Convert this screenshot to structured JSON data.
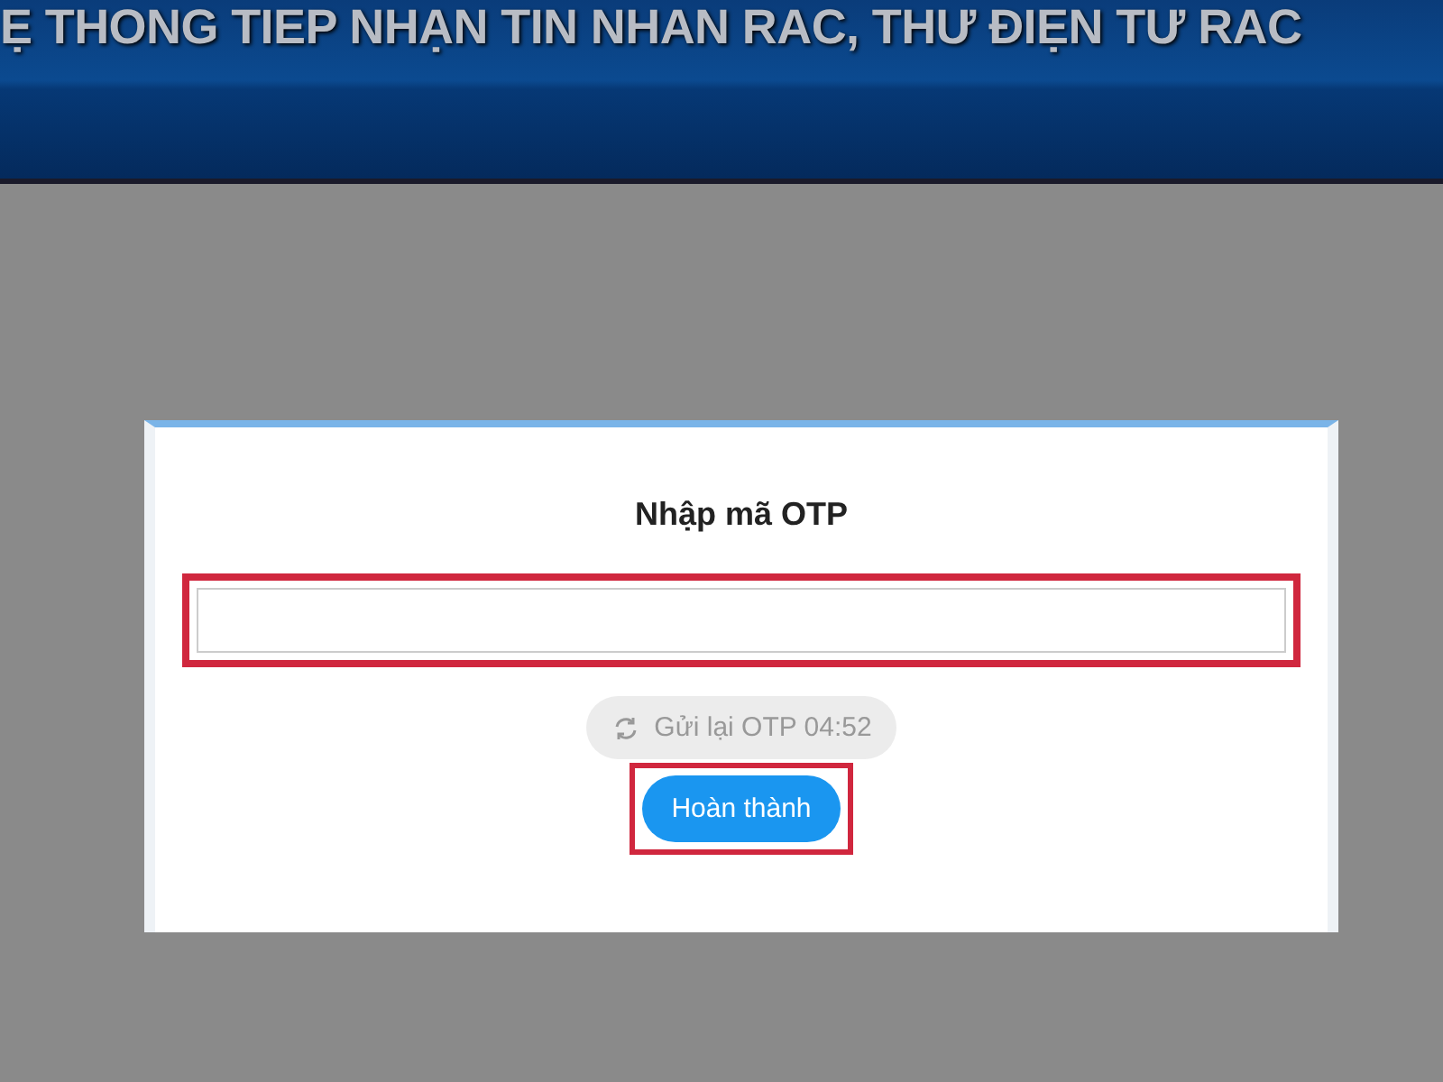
{
  "header": {
    "title": "Ẹ THONG TIEP NHẠN TIN NHAN RAC, THƯ ĐIẸN TƯ RAC"
  },
  "dialog": {
    "title": "Nhập mã OTP",
    "otp_field": {
      "highlighted": true
    },
    "resend_button": {
      "label": "Gửi lại OTP 04:52",
      "disabled": true
    },
    "submit_button": {
      "label": "Hoàn thành",
      "highlighted": true
    }
  }
}
